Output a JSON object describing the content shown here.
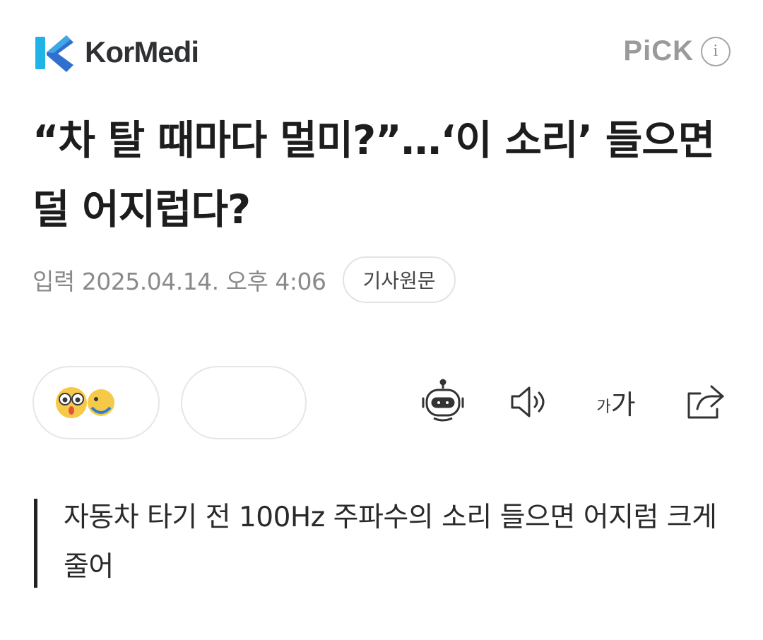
{
  "header": {
    "logo_kor": "KorMedi",
    "pick_label": "PiCK",
    "info_label": "i"
  },
  "article": {
    "title": "“차 탈 때마다 멀미?”…‘이 소리’ 들으면 덜 어지럽다?",
    "date_label": "입력",
    "date": "2025.04.14. 오후 4:06",
    "source_button": "기사원문",
    "summary": "자동차 타기 전 100Hz 주파수의 소리 들으면 어지럼 크게 줄어"
  },
  "toolbar": {
    "font_small": "가",
    "font_large": "가"
  },
  "reactions": [
    {
      "icons": [
        "surprised-face-icon",
        "smiling-face-icon"
      ],
      "count": ""
    },
    {
      "label": ""
    }
  ],
  "colors": {
    "logo_blue": "#2f8fd6",
    "logo_cyan": "#1fb3e8",
    "logo_dark": "#2f3033",
    "pick_gray": "#9a9a9a",
    "text_dark": "#1d1d1d",
    "meta_gray": "#8a8a8a"
  }
}
